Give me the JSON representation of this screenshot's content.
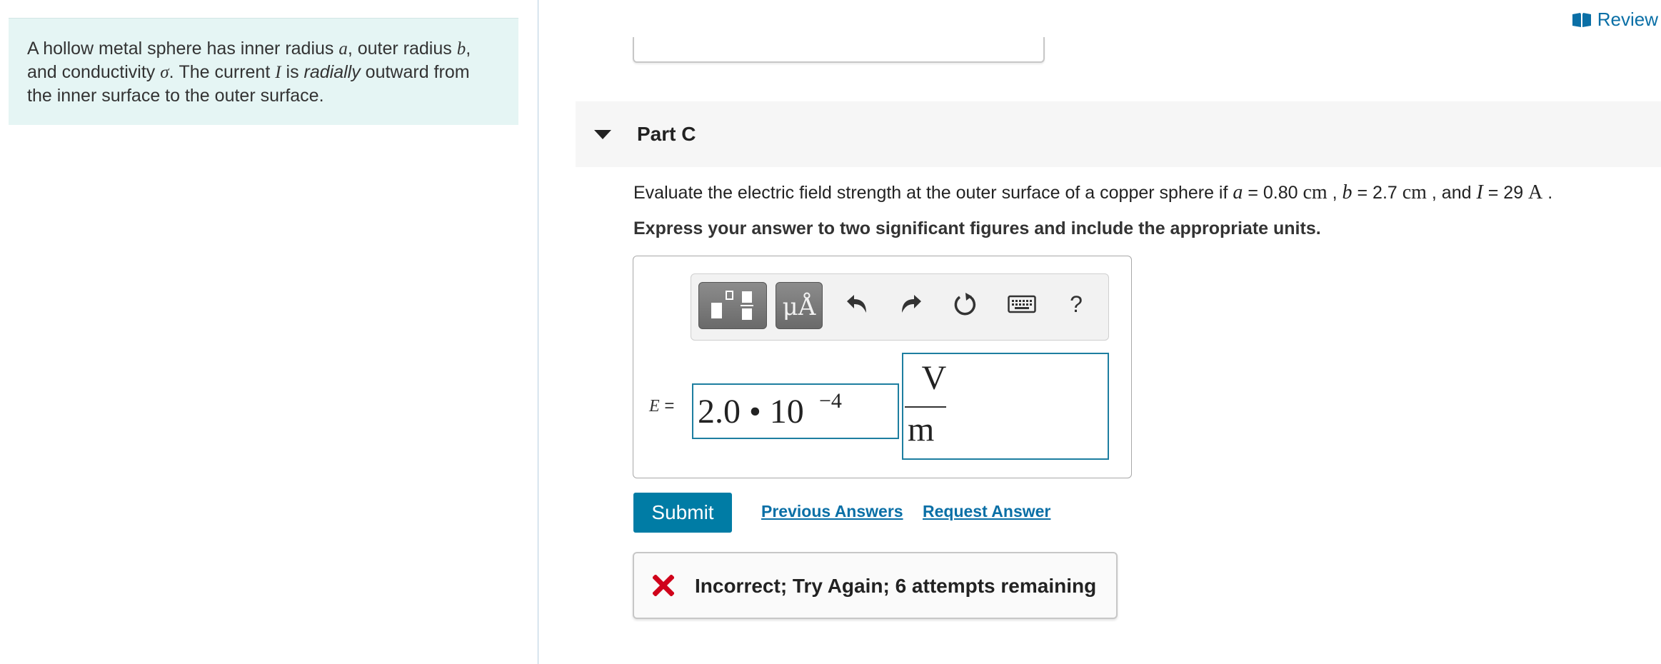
{
  "header": {
    "review_label": "Review",
    "icon": "book-icon",
    "accent": "#0a6fa6"
  },
  "problem": {
    "t1": "A hollow metal sphere has inner radius ",
    "v_a": "a",
    "t2": ", outer radius ",
    "v_b": "b",
    "t3": ",",
    "t4": "and conductivity ",
    "v_sigma": "σ",
    "t5": ". The current ",
    "v_I": "I",
    "t6": " is ",
    "t7": "radially",
    "t8": " outward from",
    "t9": "the inner surface to the outer surface.",
    "background": "#e5f5f4"
  },
  "part": {
    "title": "Part C",
    "icon": "caret-down-icon"
  },
  "question": {
    "t1": "Evaluate the electric field strength at the outer surface of a copper sphere if ",
    "a_var": "a",
    "eq1": " = 0.80 ",
    "a_unit": "cm",
    "sep1": " , ",
    "b_var": "b",
    "eq2": " = 2.7 ",
    "b_unit": "cm",
    "sep2": " , and ",
    "i_var": "I",
    "eq3": " = 29 ",
    "i_unit": "A",
    "end": " ."
  },
  "instruction": "Express your answer to two significant figures and include the appropriate units.",
  "toolbar": {
    "templates_icon": "templates-icon",
    "units_label": "μÅ",
    "undo_icon": "undo-icon",
    "redo_icon": "redo-icon",
    "reset_icon": "reset-icon",
    "keyboard_icon": "keyboard-icon",
    "help_label": "?"
  },
  "answer": {
    "label": "E",
    "label_eq": " =",
    "value": "2.0 • 10",
    "exponent": "−4",
    "unit_numerator": "V",
    "unit_denominator": "m"
  },
  "actions": {
    "submit": "Submit",
    "previous_answers": "Previous Answers",
    "request_answer": "Request Answer",
    "button_color": "#007ca5"
  },
  "feedback": {
    "message": "Incorrect; Try Again; 6 attempts remaining",
    "icon": "x-icon",
    "icon_color": "#d0021b"
  }
}
